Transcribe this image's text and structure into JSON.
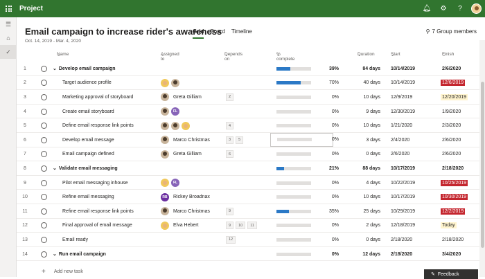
{
  "app": {
    "title": "Project"
  },
  "plan": {
    "title": "Email campaign to increase rider's awareness",
    "dates": "Oct. 14, 2019 - Mar. 4, 2020",
    "views": [
      "Grid",
      "Board",
      "Timeline"
    ],
    "members": "7 Group members"
  },
  "columns": {
    "name": "Name",
    "assigned": "Assigned to",
    "depends": "Depends on",
    "pct": "% complete",
    "duration": "Duration",
    "start": "Start",
    "finish": "Finish"
  },
  "rows": [
    {
      "n": "1",
      "bucket": true,
      "name": "Develop email campaign",
      "assignees": [],
      "person": "",
      "deps": [],
      "pct": 39,
      "pct_label": "39%",
      "duration": "84 days",
      "start": "10/14/2019",
      "finish": "2/6/2020",
      "flag": ""
    },
    {
      "n": "2",
      "name": "Target audience profile",
      "assignees": [
        "blond",
        "photo"
      ],
      "person": "",
      "deps": [],
      "pct": 70,
      "pct_label": "70%",
      "duration": "40 days",
      "start": "10/14/2019",
      "finish": "12/6/2019",
      "flag": "late"
    },
    {
      "n": "3",
      "name": "Marketing approval of storyboard",
      "assignees": [
        "photo"
      ],
      "person": "Greta Gilliam",
      "deps": [
        "2"
      ],
      "pct": 0,
      "pct_label": "0%",
      "duration": "10 days",
      "start": "12/9/2019",
      "finish": "12/20/2019",
      "flag": "today"
    },
    {
      "n": "4",
      "name": "Create email storyboard",
      "assignees": [
        "photo",
        "FL"
      ],
      "person": "",
      "deps": [],
      "pct": 0,
      "pct_label": "0%",
      "duration": "9 days",
      "start": "12/30/2019",
      "finish": "1/9/2020",
      "flag": ""
    },
    {
      "n": "5",
      "name": "Define email response link points",
      "assignees": [
        "photo",
        "photo",
        "blond"
      ],
      "person": "",
      "deps": [
        "4"
      ],
      "pct": 0,
      "pct_label": "0%",
      "duration": "10 days",
      "start": "1/21/2020",
      "finish": "2/3/2020",
      "flag": ""
    },
    {
      "n": "6",
      "name": "Develop email message",
      "assignees": [
        "photo"
      ],
      "person": "Marco Christmas",
      "deps": [
        "3",
        "5"
      ],
      "pct": 0,
      "pct_label": "0%",
      "duration": "3 days",
      "start": "2/4/2020",
      "finish": "2/6/2020",
      "flag": "",
      "boxed": true
    },
    {
      "n": "7",
      "name": "Email campaign defined",
      "assignees": [
        "photo"
      ],
      "person": "Greta Gilliam",
      "deps": [
        "6"
      ],
      "pct": 0,
      "pct_label": "0%",
      "duration": "0 days",
      "start": "2/6/2020",
      "finish": "2/6/2020",
      "flag": ""
    },
    {
      "n": "8",
      "bucket": true,
      "name": "Validate email messaging",
      "assignees": [],
      "person": "",
      "deps": [],
      "pct": 21,
      "pct_label": "21%",
      "duration": "88 days",
      "start": "10/17/2019",
      "finish": "2/18/2020",
      "flag": ""
    },
    {
      "n": "9",
      "name": "Pilot email messaging inhouse",
      "assignees": [
        "blond",
        "FL"
      ],
      "person": "",
      "deps": [],
      "pct": 0,
      "pct_label": "0%",
      "duration": "4 days",
      "start": "10/22/2019",
      "finish": "10/25/2019",
      "flag": "late"
    },
    {
      "n": "10",
      "name": "Refine email messaging",
      "assignees": [
        "RB"
      ],
      "person": "Rickey Broadnax",
      "deps": [],
      "pct": 0,
      "pct_label": "0%",
      "duration": "10 days",
      "start": "10/17/2019",
      "finish": "10/30/2019",
      "flag": "late"
    },
    {
      "n": "11",
      "name": "Refine email response link points",
      "assignees": [
        "photo"
      ],
      "person": "Marco Christmas",
      "deps": [
        "9"
      ],
      "pct": 35,
      "pct_label": "35%",
      "duration": "25 days",
      "start": "10/29/2019",
      "finish": "12/2/2019",
      "flag": "late"
    },
    {
      "n": "12",
      "name": "Final approval of email message",
      "assignees": [
        "blond"
      ],
      "person": "Elva Hebert",
      "deps": [
        "9",
        "10",
        "11"
      ],
      "pct": 0,
      "pct_label": "0%",
      "duration": "2 days",
      "start": "12/18/2019",
      "finish": "Today",
      "flag": "today"
    },
    {
      "n": "13",
      "name": "Email ready",
      "assignees": [],
      "person": "",
      "deps": [
        "12"
      ],
      "pct": 0,
      "pct_label": "0%",
      "duration": "0 days",
      "start": "2/18/2020",
      "finish": "2/18/2020",
      "flag": ""
    },
    {
      "n": "14",
      "bucket": true,
      "name": "Run email campaign",
      "assignees": [],
      "person": "",
      "deps": [],
      "pct": 0,
      "pct_label": "0%",
      "duration": "12 days",
      "start": "2/18/2020",
      "finish": "3/4/2020",
      "flag": ""
    }
  ],
  "add_task": "Add new task",
  "feedback": "Feedback"
}
